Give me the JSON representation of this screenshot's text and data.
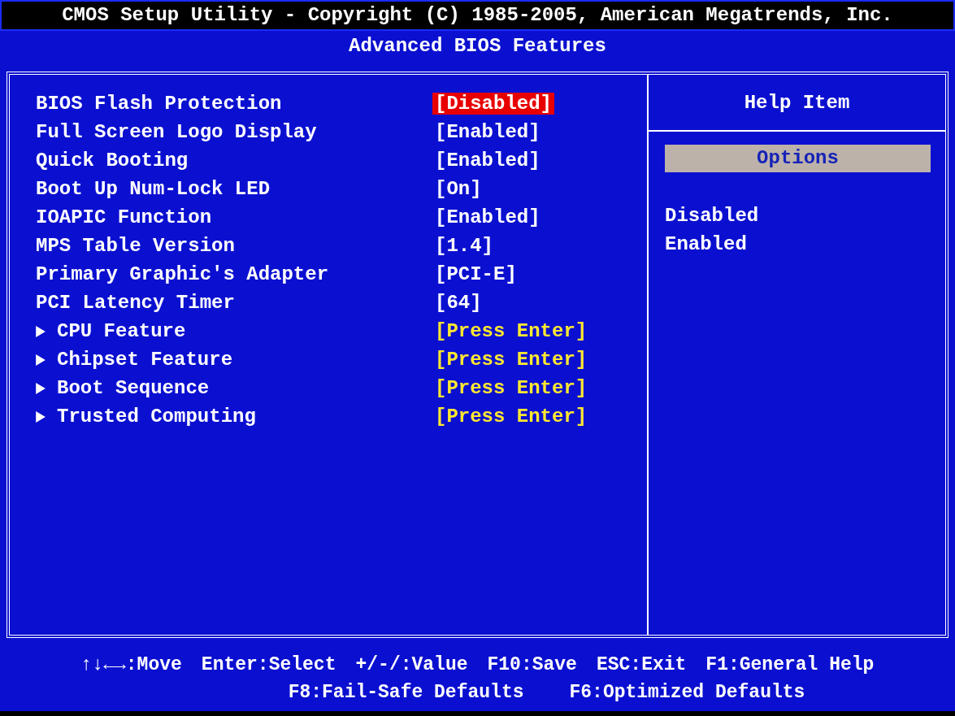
{
  "title_bar": "CMOS Setup Utility - Copyright (C) 1985-2005, American Megatrends, Inc.",
  "page_title": "Advanced BIOS Features",
  "settings": [
    {
      "kind": "setting",
      "label": "BIOS Flash Protection",
      "value": "[Disabled]",
      "selected": true
    },
    {
      "kind": "setting",
      "label": "Full Screen Logo Display",
      "value": "[Enabled]",
      "selected": false
    },
    {
      "kind": "setting",
      "label": "Quick Booting",
      "value": "[Enabled]",
      "selected": false
    },
    {
      "kind": "setting",
      "label": "Boot Up Num-Lock LED",
      "value": "[On]",
      "selected": false
    },
    {
      "kind": "setting",
      "label": "IOAPIC Function",
      "value": "[Enabled]",
      "selected": false
    },
    {
      "kind": "setting",
      "label": "MPS Table Version",
      "value": "[1.4]",
      "selected": false
    },
    {
      "kind": "setting",
      "label": "Primary Graphic's Adapter",
      "value": "[PCI-E]",
      "selected": false
    },
    {
      "kind": "setting",
      "label": "PCI Latency Timer",
      "value": "[64]",
      "selected": false
    },
    {
      "kind": "submenu",
      "label": "CPU Feature",
      "value": "[Press Enter]",
      "selected": false
    },
    {
      "kind": "submenu",
      "label": "Chipset Feature",
      "value": "[Press Enter]",
      "selected": false
    },
    {
      "kind": "submenu",
      "label": "Boot Sequence",
      "value": "[Press Enter]",
      "selected": false
    },
    {
      "kind": "submenu",
      "label": "Trusted Computing",
      "value": "[Press Enter]",
      "selected": false
    }
  ],
  "help": {
    "title": "Help Item",
    "options_heading": "Options",
    "options": [
      "Disabled",
      "Enabled"
    ]
  },
  "footer": [
    [
      "↑↓←→:Move",
      "Enter:Select",
      "+/-/:Value",
      "F10:Save",
      "ESC:Exit",
      "F1:General Help"
    ],
    [
      "F8:Fail-Safe Defaults",
      "F6:Optimized Defaults"
    ]
  ]
}
